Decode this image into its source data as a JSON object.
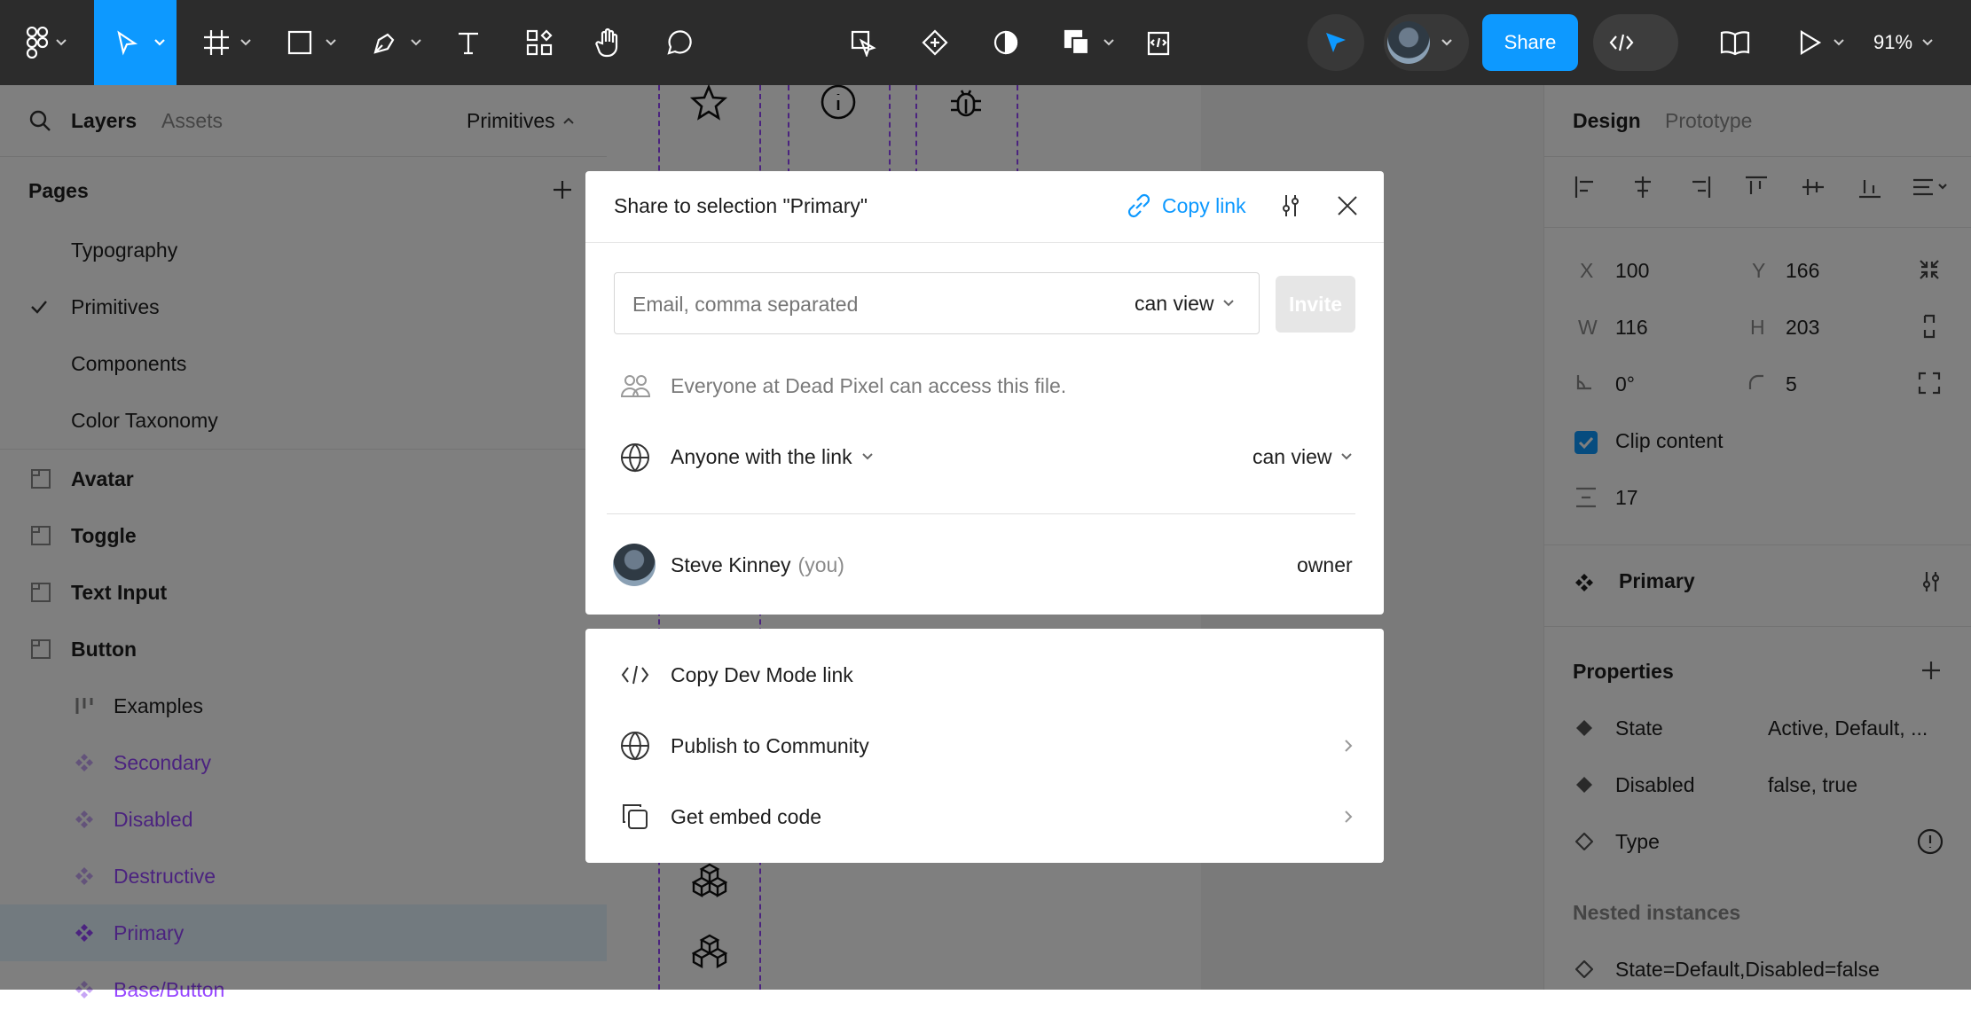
{
  "toolbar": {
    "share_label": "Share",
    "zoom_label": "91%"
  },
  "left_panel": {
    "tabs": {
      "layers": "Layers",
      "assets": "Assets",
      "page_selector": "Primitives"
    },
    "pages_title": "Pages",
    "pages": [
      {
        "label": "Typography"
      },
      {
        "label": "Primitives"
      },
      {
        "label": "Components"
      },
      {
        "label": "Color Taxonomy"
      }
    ],
    "layers": [
      {
        "label": "Avatar"
      },
      {
        "label": "Toggle"
      },
      {
        "label": "Text Input"
      },
      {
        "label": "Button"
      },
      {
        "label": "Examples"
      },
      {
        "label": "Secondary"
      },
      {
        "label": "Disabled"
      },
      {
        "label": "Destructive"
      },
      {
        "label": "Primary"
      },
      {
        "label": "Base/Button"
      }
    ]
  },
  "right_panel": {
    "tabs": {
      "design": "Design",
      "prototype": "Prototype"
    },
    "x_label": "X",
    "x_value": "100",
    "y_label": "Y",
    "y_value": "166",
    "w_label": "W",
    "w_value": "116",
    "h_label": "H",
    "h_value": "203",
    "rotation_value": "0°",
    "radius_value": "5",
    "clip_content_label": "Clip content",
    "spacing_value": "17",
    "component_name": "Primary",
    "properties_title": "Properties",
    "properties": [
      {
        "name": "State",
        "value": "Active, Default, ..."
      },
      {
        "name": "Disabled",
        "value": "false, true"
      },
      {
        "name": "Type",
        "value": ""
      }
    ],
    "nested_title": "Nested instances",
    "nested_item": "State=Default,Disabled=false"
  },
  "share_dialog": {
    "title": "Share to selection \"Primary\"",
    "copy_link_label": "Copy link",
    "email_placeholder": "Email, comma separated",
    "email_permission": "can view",
    "invite_label": "Invite",
    "org_access_text": "Everyone at Dead Pixel can access this file.",
    "link_access_label": "Anyone with the link",
    "link_permission": "can view",
    "user_name": "Steve Kinney",
    "user_you": "(you)",
    "user_role": "owner"
  },
  "share_menu": {
    "items": [
      {
        "label": "Copy Dev Mode link"
      },
      {
        "label": "Publish to Community"
      },
      {
        "label": "Get embed code"
      }
    ]
  },
  "colors": {
    "toolbar_bg": "#2c2c2c",
    "accent_blue": "#0d99ff",
    "component_purple": "#9747ff",
    "overlay": "rgba(0,0,0,0.5)"
  }
}
